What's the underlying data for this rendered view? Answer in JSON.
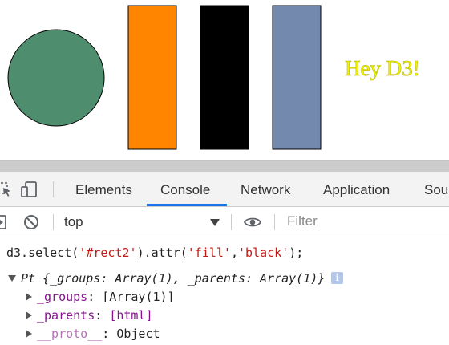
{
  "canvas": {
    "circle": {
      "color": "#4e8d6e"
    },
    "rects": [
      {
        "id": "rect1",
        "color": "#ff8500"
      },
      {
        "id": "rect2",
        "color": "#000000"
      },
      {
        "id": "rect3",
        "color": "#7489ae"
      }
    ],
    "text": "Hey D3!",
    "text_color": "#f4f400"
  },
  "devtools": {
    "tabs": [
      {
        "label": "Elements",
        "active": false
      },
      {
        "label": "Console",
        "active": true
      },
      {
        "label": "Network",
        "active": false
      },
      {
        "label": "Application",
        "active": false
      },
      {
        "label": "Sou",
        "active": false
      }
    ],
    "accent_color": "#1a73e8",
    "icons": {
      "inspect": "inspect-element-icon",
      "device": "device-toolbar-icon",
      "sidebar": "console-sidebar-icon",
      "clear": "clear-console-icon",
      "eye": "live-expression-eye-icon"
    },
    "context_select": {
      "value": "top"
    },
    "filter": {
      "placeholder": "Filter",
      "value": ""
    }
  },
  "console": {
    "command": {
      "prefix": "d3.select(",
      "arg1": "'#rect2'",
      "mid": ").attr(",
      "arg2": "'fill'",
      "comma": ",",
      "arg3": "'black'",
      "suffix": ");"
    },
    "result": {
      "summary": "Pt {_groups: Array(1), _parents: Array(1)}",
      "info_badge": "i",
      "children": [
        {
          "key": "_groups",
          "sep": ": ",
          "value": "[Array(1)]"
        },
        {
          "key": "_parents",
          "sep": ": ",
          "value": "[html]"
        },
        {
          "key": "__proto__",
          "sep": ": ",
          "value": "Object"
        }
      ]
    }
  }
}
